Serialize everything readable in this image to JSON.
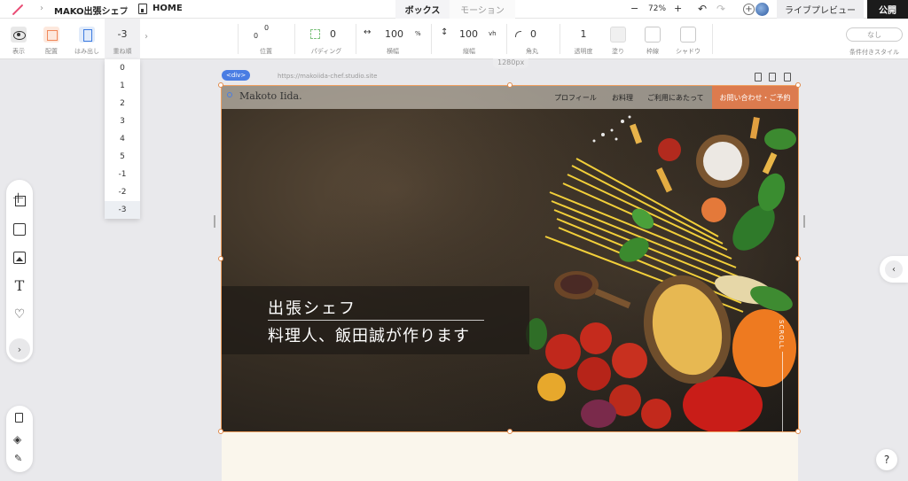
{
  "topbar": {
    "site_name": "MAKO出張シェフ",
    "page_name": "HOME",
    "tabs": [
      {
        "label": "ボックス",
        "active": true
      },
      {
        "label": "モーション",
        "active": false
      }
    ],
    "zoom_minus": "−",
    "zoom_level": "72%",
    "zoom_plus": "+",
    "preview_label": "ライブプレビュー",
    "publish_label": "公開"
  },
  "toolbar": {
    "visibility_label": "表示",
    "placement_label": "配置",
    "overflow_label": "はみ出し",
    "z_index_value": "-3",
    "z_index_label": "重ね順",
    "position_label": "位置",
    "position_x": "0",
    "position_y": "0",
    "padding_label": "パディング",
    "padding_value": "0",
    "width_label": "横幅",
    "width_value": "100",
    "width_unit": "%",
    "height_label": "縦幅",
    "height_value": "100",
    "height_unit": "vh",
    "radius_label": "角丸",
    "radius_value": "0",
    "opacity_label": "透明度",
    "opacity_value": "1",
    "fill_label": "塗り",
    "border_label": "枠線",
    "shadow_label": "シャドウ",
    "conditional_value": "なし",
    "conditional_label": "条件付きスタイル"
  },
  "z_index_options": [
    "0",
    "1",
    "2",
    "3",
    "4",
    "5",
    "-1",
    "-2",
    "-3"
  ],
  "z_index_selected": "-3",
  "canvas": {
    "width_label": "1280px",
    "element_tag": "<div>",
    "site_url": "https://makoiida-chef.studio.site"
  },
  "site": {
    "brand": "Makoto Iida.",
    "nav_links": [
      "プロフィール",
      "お料理",
      "ご利用にあたって"
    ],
    "contact_button": "お問い合わせ・ご予約",
    "tagline_line1": "出張シェフ",
    "tagline_line2": "料理人、飯田誠が作ります",
    "scroll_label": "SCROLL"
  },
  "help_label": "?",
  "colors": {
    "accent_orange": "#dc7b4e",
    "selection_blue": "#4a7de3",
    "publish_bg": "#1b1b1b"
  }
}
